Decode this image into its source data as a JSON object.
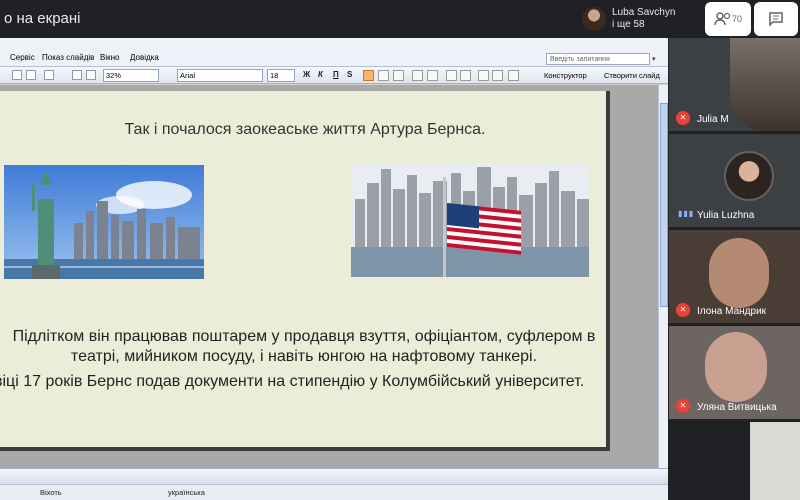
{
  "top": {
    "share_title": "о на екрані",
    "presenter_name": "Luba Savchyn",
    "presenter_extra": "і ще 58",
    "people_count": "70",
    "icons": [
      "people-icon",
      "chat-icon"
    ]
  },
  "app": {
    "menu": [
      "Сервіс",
      "Показ слайдів",
      "Вікно",
      "Довідка"
    ],
    "help_placeholder": "Введіть запитання",
    "zoom": "32%",
    "font": "Arial",
    "font_size": "18",
    "format_buttons": [
      "Ж",
      "К",
      "П",
      "S"
    ],
    "designer": "Конструктор",
    "new_slide": "Створити слайд"
  },
  "slide": {
    "title": "Так і почалося заокеаське життя Артура Бернса.",
    "line1": "Підлітком він працював поштарем у продавця взуття, офіціантом, суфлером в",
    "line2": "театрі, мийником посуду, і навіть юнгою на нафтовому танкері.",
    "line3": "віці 17 років Бернс подав документи на стипендію у Колумбійський університет."
  },
  "status": {
    "left": "Віхоть",
    "language": "українська"
  },
  "participants": [
    {
      "name": "Julia M",
      "muted": true
    },
    {
      "name": "Yulia Luzhna",
      "muted": false
    },
    {
      "name": "Ілона Мандрик",
      "muted": true
    },
    {
      "name": "Уляна Витвицька",
      "muted": true
    }
  ]
}
